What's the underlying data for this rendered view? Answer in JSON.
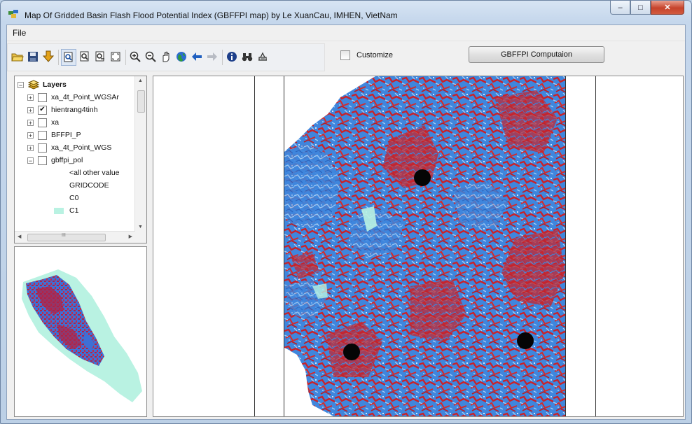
{
  "window": {
    "title": "Map Of Gridded Basin Flash Flood Potential Index (GBFFPI map) by Le XuanCau, IMHEN, VietNam",
    "controls": {
      "minimize": "–",
      "maximize": "□",
      "close": "✕"
    }
  },
  "menu": {
    "file": "File"
  },
  "toolbar": {
    "icons": [
      "open-folder-icon",
      "save-icon",
      "add-data-icon",
      "zoom-to-layer-icon",
      "zoom-to-selection-icon",
      "zoom-prev-icon",
      "full-extent-icon",
      "zoom-in-icon",
      "zoom-out-icon",
      "pan-hand-icon",
      "globe-icon",
      "back-arrow-icon",
      "forward-arrow-icon",
      "identify-icon",
      "find-binoculars-icon",
      "measure-icon"
    ]
  },
  "customize": {
    "label": "Customize",
    "checked": false
  },
  "compute_button": {
    "label": "GBFFPI Computaion"
  },
  "toc": {
    "root_label": "Layers",
    "layers": [
      {
        "label": "xa_4t_Point_WGSAr",
        "checked": false,
        "expander": "+"
      },
      {
        "label": "hientrang4tinh",
        "checked": true,
        "expander": "+"
      },
      {
        "label": "xa",
        "checked": false,
        "expander": "+"
      },
      {
        "label": "BFFPI_P",
        "checked": false,
        "expander": "+"
      },
      {
        "label": "xa_4t_Point_WGS",
        "checked": false,
        "expander": "+"
      },
      {
        "label": "gbffpi_pol",
        "checked": false,
        "expander": "−"
      }
    ],
    "legend": {
      "other_values": "<all other value",
      "field": "GRIDCODE",
      "classes": [
        "C0",
        "C1"
      ],
      "c1_color": "#b9f2e2"
    },
    "hscroll_mark": "III"
  },
  "colors": {
    "flood_red": "#c8222a",
    "river_blue": "#3f86dd",
    "light_blue": "#a7cdf2",
    "basin_aqua": "#b9f2e2"
  },
  "map": {
    "points_count": 3
  }
}
